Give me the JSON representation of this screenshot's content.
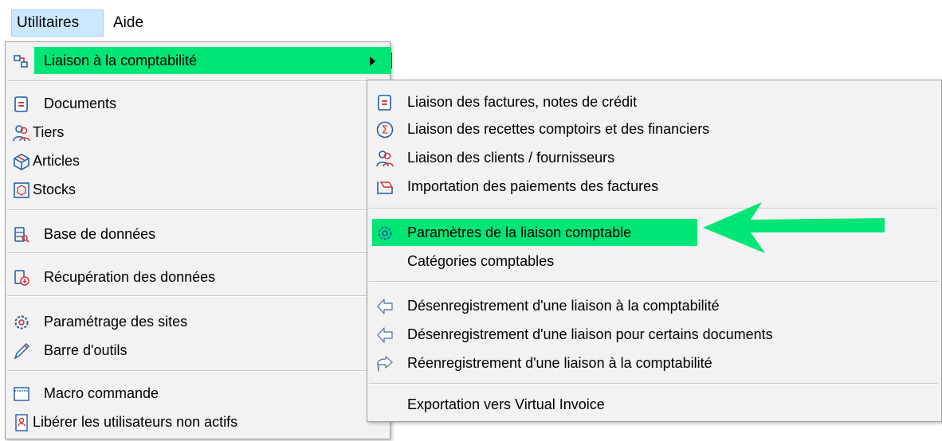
{
  "menubar": {
    "utilitaires": "Utilitaires",
    "aide": "Aide"
  },
  "menu1": {
    "liaison": "Liaison à la comptabilité",
    "documents": "Documents",
    "tiers": "Tiers",
    "articles": "Articles",
    "stocks": "Stocks",
    "base": "Base de données",
    "recuperation": "Récupération des données",
    "parametrage": "Paramétrage des sites",
    "barre": "Barre d'outils",
    "macro": "Macro commande",
    "liberer": "Libérer les utilisateurs non actifs"
  },
  "menu2": {
    "factures": "Liaison des factures, notes de crédit",
    "recettes": "Liaison des recettes comptoirs et des financiers",
    "clients": "Liaison des clients / fournisseurs",
    "importation": "Importation des paiements des factures",
    "parametres": "Paramètres de la liaison comptable",
    "categories": "Catégories comptables",
    "desenreg1": "Désenregistrement d'une liaison à la comptabilité",
    "desenreg2": "Désenregistrement d'une liaison pour certains documents",
    "reenreg": "Réenregistrement d'une liaison à la comptabilité",
    "export": "Exportation vers Virtual Invoice"
  },
  "colors": {
    "highlight": "#00e676",
    "menubar_active": "#cce8ff",
    "icon_blue": "#1e5aa8",
    "icon_red": "#d03030"
  }
}
